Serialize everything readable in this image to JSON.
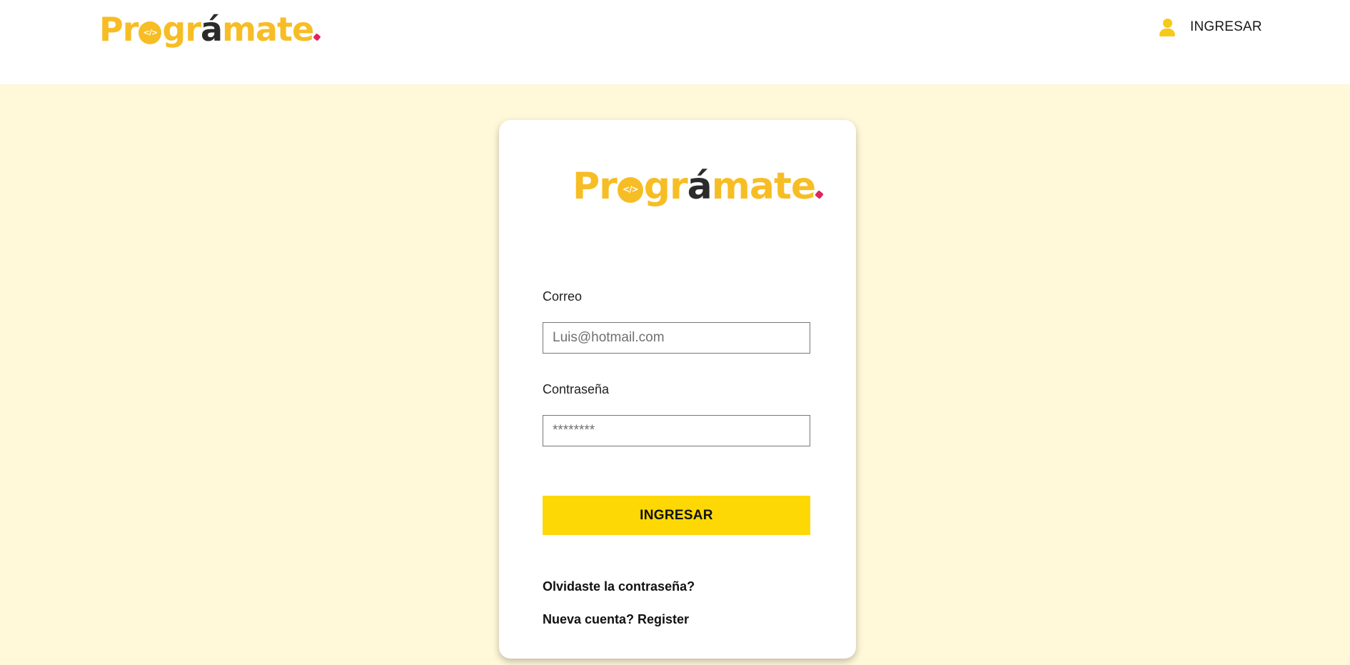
{
  "brand": {
    "logo_text": "Programate",
    "colors": {
      "brand_yellow": "#f7bd24",
      "button_yellow": "#fdd805",
      "page_background": "#fff8d9",
      "accent_pink": "#e0245e"
    }
  },
  "header": {
    "login_icon": "user-icon",
    "login_label": "INGRESAR"
  },
  "login_form": {
    "email_label": "Correo",
    "email_placeholder": "Luis@hotmail.com",
    "email_value": "",
    "password_label": "Contraseña",
    "password_placeholder": "********",
    "password_value": "",
    "submit_label": "INGRESAR",
    "forgot_password_link": "Olvidaste la contraseña?",
    "register_link": "Nueva cuenta? Register"
  }
}
